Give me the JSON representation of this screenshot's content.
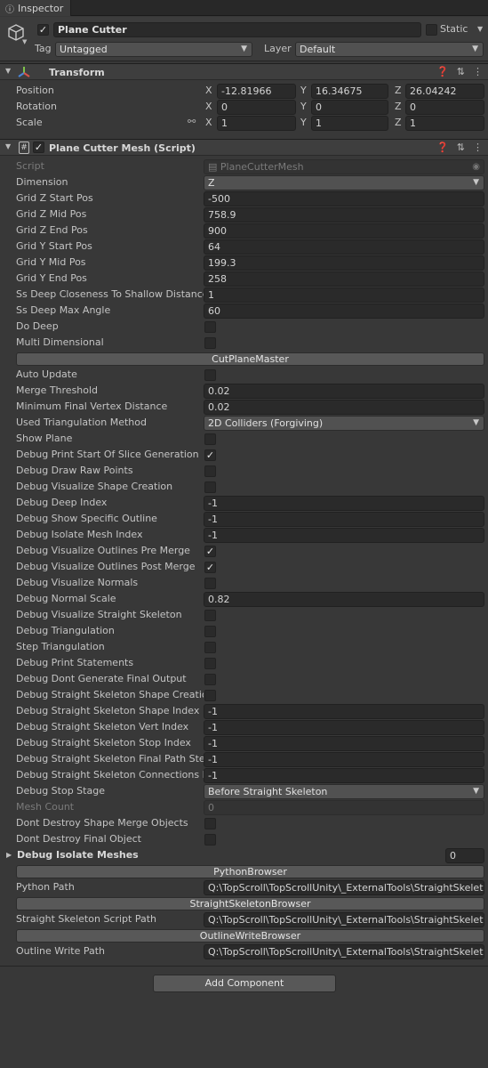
{
  "tab": {
    "label": "Inspector"
  },
  "header": {
    "name": "Plane Cutter",
    "active": true,
    "static_label": "Static",
    "tag_label": "Tag",
    "tag_value": "Untagged",
    "layer_label": "Layer",
    "layer_value": "Default"
  },
  "transform": {
    "title": "Transform",
    "rows": [
      {
        "label": "Position",
        "x": "-12.81966",
        "y": "16.34675",
        "z": "26.04242"
      },
      {
        "label": "Rotation",
        "x": "0",
        "y": "0",
        "z": "0"
      },
      {
        "label": "Scale",
        "x": "1",
        "y": "1",
        "z": "1"
      }
    ],
    "axis": {
      "x": "X",
      "y": "Y",
      "z": "Z"
    }
  },
  "script_component": {
    "title": "Plane Cutter Mesh (Script)",
    "enabled": true
  },
  "props": [
    {
      "label": "Script",
      "type": "script",
      "value": "PlaneCutterMesh",
      "disabled": true
    },
    {
      "label": "Dimension",
      "type": "dropdown",
      "value": "Z"
    },
    {
      "label": "Grid Z Start Pos",
      "type": "field",
      "value": "-500"
    },
    {
      "label": "Grid Z Mid Pos",
      "type": "field",
      "value": "758.9"
    },
    {
      "label": "Grid Z End Pos",
      "type": "field",
      "value": "900"
    },
    {
      "label": "Grid Y Start Pos",
      "type": "field",
      "value": "64"
    },
    {
      "label": "Grid Y Mid Pos",
      "type": "field",
      "value": "199.3"
    },
    {
      "label": "Grid Y End Pos",
      "type": "field",
      "value": "258"
    },
    {
      "label": "Ss Deep Closeness To Shallow Distance",
      "type": "field",
      "value": "1"
    },
    {
      "label": "Ss Deep Max Angle",
      "type": "field",
      "value": "60"
    },
    {
      "label": "Do Deep",
      "type": "check",
      "checked": false
    },
    {
      "label": "Multi Dimensional",
      "type": "check",
      "checked": false
    },
    {
      "label": "CutPlaneMaster",
      "type": "button"
    },
    {
      "label": "Auto Update",
      "type": "check",
      "checked": false
    },
    {
      "label": "Merge Threshold",
      "type": "field",
      "value": "0.02"
    },
    {
      "label": "Minimum Final Vertex Distance",
      "type": "field",
      "value": "0.02"
    },
    {
      "label": "Used Triangulation Method",
      "type": "dropdown",
      "value": "2D Colliders (Forgiving)"
    },
    {
      "label": "Show Plane",
      "type": "check",
      "checked": false
    },
    {
      "label": "Debug Print Start Of Slice Generation",
      "type": "check",
      "checked": true
    },
    {
      "label": "Debug Draw Raw Points",
      "type": "check",
      "checked": false
    },
    {
      "label": "Debug Visualize Shape Creation",
      "type": "check",
      "checked": false
    },
    {
      "label": "Debug Deep Index",
      "type": "field",
      "value": "-1"
    },
    {
      "label": "Debug Show Specific Outline",
      "type": "field",
      "value": "-1"
    },
    {
      "label": "Debug Isolate Mesh Index",
      "type": "field",
      "value": "-1"
    },
    {
      "label": "Debug Visualize Outlines Pre Merge",
      "type": "check",
      "checked": true
    },
    {
      "label": "Debug Visualize Outlines Post Merge",
      "type": "check",
      "checked": true
    },
    {
      "label": "Debug Visualize Normals",
      "type": "check",
      "checked": false
    },
    {
      "label": "Debug Normal Scale",
      "type": "field",
      "value": "0.82"
    },
    {
      "label": "Debug Visualize Straight Skeleton",
      "type": "check",
      "checked": false
    },
    {
      "label": "Debug Triangulation",
      "type": "check",
      "checked": false
    },
    {
      "label": "Step Triangulation",
      "type": "check",
      "checked": false
    },
    {
      "label": "Debug Print Statements",
      "type": "check",
      "checked": false
    },
    {
      "label": "Debug Dont Generate Final Output",
      "type": "check",
      "checked": false
    },
    {
      "label": "Debug Straight Skeleton Shape Creation",
      "type": "check",
      "checked": false
    },
    {
      "label": "Debug Straight Skeleton Shape Index",
      "type": "field",
      "value": "-1"
    },
    {
      "label": "Debug Straight Skeleton Vert Index",
      "type": "field",
      "value": "-1"
    },
    {
      "label": "Debug Straight Skeleton Stop Index",
      "type": "field",
      "value": "-1"
    },
    {
      "label": "Debug Straight Skeleton Final Path Step",
      "type": "field",
      "value": "-1"
    },
    {
      "label": "Debug Straight Skeleton Connections In",
      "type": "field",
      "value": "-1"
    },
    {
      "label": "Debug Stop Stage",
      "type": "dropdown",
      "value": "Before Straight Skeleton"
    },
    {
      "label": "Mesh Count",
      "type": "field",
      "value": "0",
      "disabled": true
    },
    {
      "label": "Dont Destroy Shape Merge Objects",
      "type": "check",
      "checked": false
    },
    {
      "label": "Dont Destroy Final Object",
      "type": "check",
      "checked": false
    },
    {
      "label": "Debug Isolate Meshes",
      "type": "foldout",
      "value": "0"
    },
    {
      "label": "PythonBrowser",
      "type": "button"
    },
    {
      "label": "Python Path",
      "type": "field",
      "value": "Q:\\TopScroll\\TopScrollUnity\\_ExternalTools\\StraightSkeleton\\"
    },
    {
      "label": "StraightSkeletonBrowser",
      "type": "button"
    },
    {
      "label": "Straight Skeleton Script Path",
      "type": "field",
      "value": "Q:\\TopScroll\\TopScrollUnity\\_ExternalTools\\StraightSkeleton\\"
    },
    {
      "label": "OutlineWriteBrowser",
      "type": "button"
    },
    {
      "label": "Outline Write Path",
      "type": "field",
      "value": "Q:\\TopScroll\\TopScrollUnity\\_ExternalTools\\StraightSkeleton\\"
    }
  ],
  "add_component": {
    "label": "Add Component"
  },
  "colors": {
    "panel": "#383838",
    "field": "#2a2a2a",
    "button": "#585858",
    "header": "#3e3e3e"
  }
}
